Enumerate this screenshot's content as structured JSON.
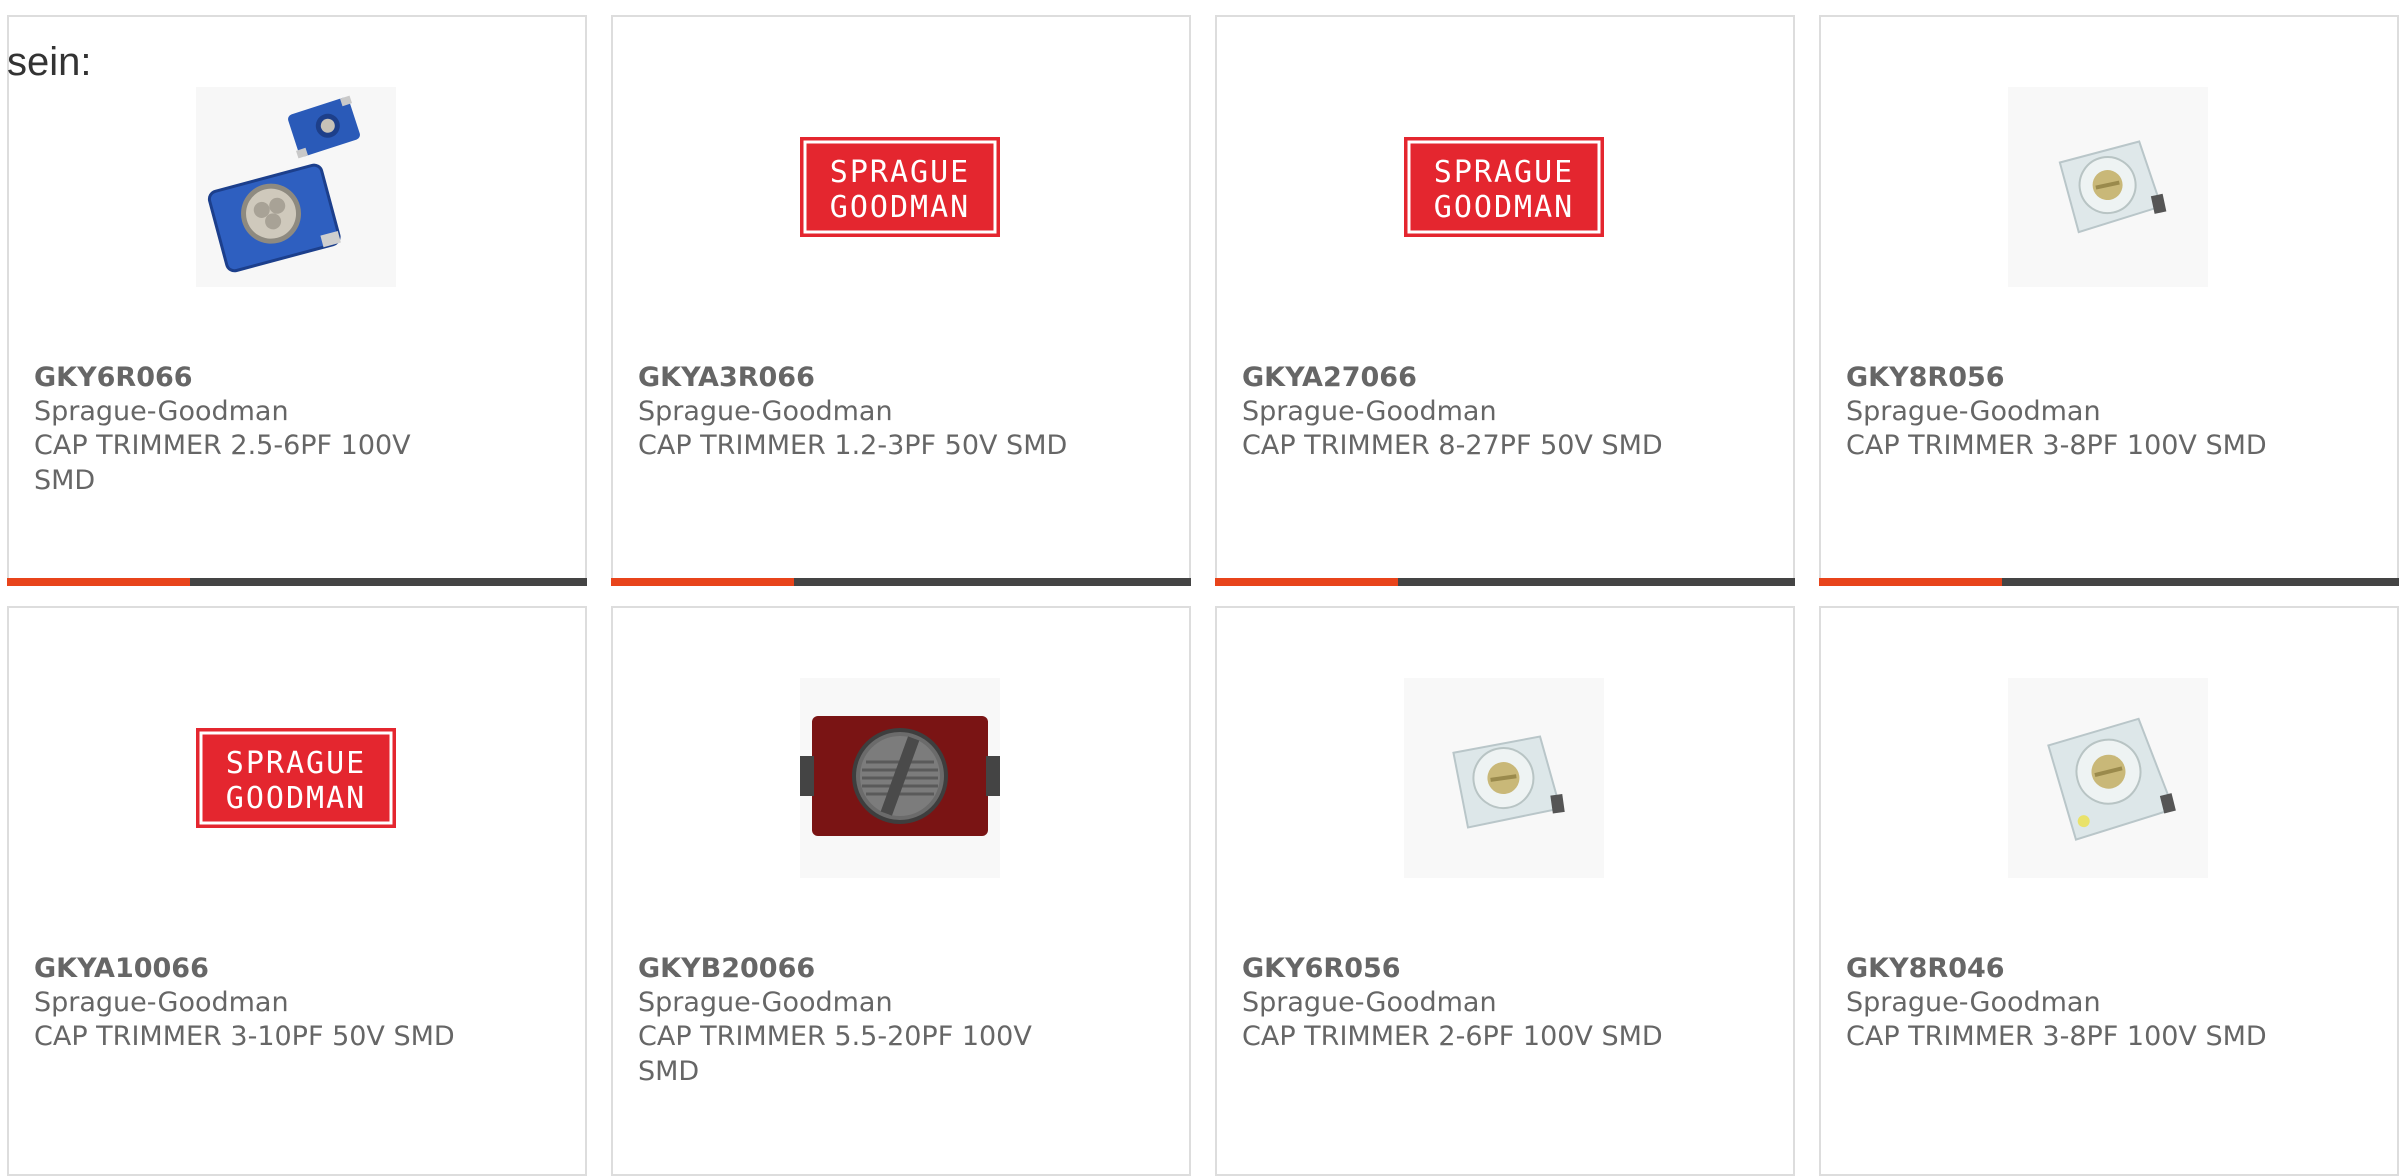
{
  "heading": "sein:",
  "colors": {
    "accent": "#e8441b",
    "bar_track": "#444444",
    "card_border": "#dddddd",
    "text": "#666666",
    "logo_red": "#e4262f"
  },
  "products": [
    {
      "part_number": "GKY6R066",
      "manufacturer": "Sprague-Goodman",
      "description": "CAP TRIMMER 2.5-6PF 100V SMD",
      "image": "blue-trimmer-pair-photo"
    },
    {
      "part_number": "GKYA3R066",
      "manufacturer": "Sprague-Goodman",
      "description": "CAP TRIMMER 1.2-3PF 50V SMD",
      "image": "sprague-goodman-logo",
      "logo_lines": [
        "SPRAGUE",
        "GOODMAN"
      ]
    },
    {
      "part_number": "GKYA27066",
      "manufacturer": "Sprague-Goodman",
      "description": "CAP TRIMMER 8-27PF 50V SMD",
      "image": "sprague-goodman-logo",
      "logo_lines": [
        "SPRAGUE",
        "GOODMAN"
      ]
    },
    {
      "part_number": "GKY8R056",
      "manufacturer": "Sprague-Goodman",
      "description": "CAP TRIMMER 3-8PF 100V SMD",
      "image": "white-trimmer-photo"
    },
    {
      "part_number": "GKYA10066",
      "manufacturer": "Sprague-Goodman",
      "description": "CAP TRIMMER 3-10PF 50V SMD",
      "image": "sprague-goodman-logo",
      "logo_lines": [
        "SPRAGUE",
        "GOODMAN"
      ]
    },
    {
      "part_number": "GKYB20066",
      "manufacturer": "Sprague-Goodman",
      "description": "CAP TRIMMER 5.5-20PF 100V SMD",
      "image": "red-trimmer-photo"
    },
    {
      "part_number": "GKY6R056",
      "manufacturer": "Sprague-Goodman",
      "description": "CAP TRIMMER 2-6PF 100V SMD",
      "image": "white-trimmer-photo"
    },
    {
      "part_number": "GKY8R046",
      "manufacturer": "Sprague-Goodman",
      "description": "CAP TRIMMER 3-8PF 100V SMD",
      "image": "white-trimmer-photo"
    }
  ]
}
